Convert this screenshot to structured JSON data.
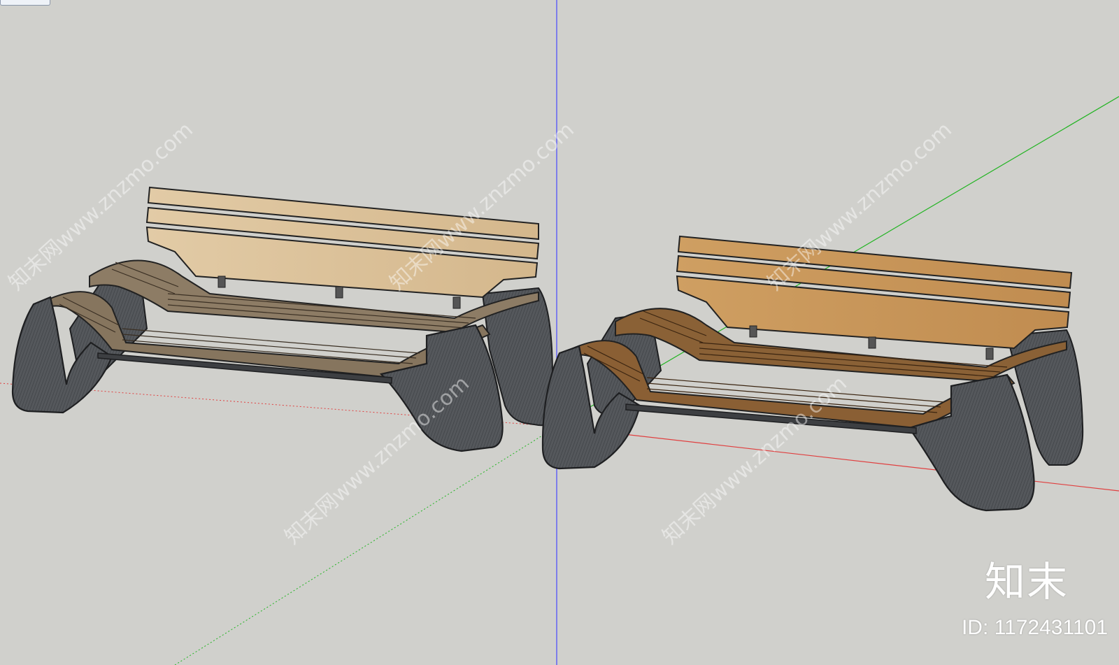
{
  "watermark": {
    "repeat_text": "知末网www.znzmo.com",
    "logo": "知末",
    "id_label": "ID: 1172431101"
  },
  "scene": {
    "colors": {
      "background": "#d0d0cc",
      "frame_metal": "#4a4c4f",
      "seat_wood_left": "#8b7a63",
      "back_wood_left": "#dcc29a",
      "seat_wood_right": "#8a6136",
      "back_wood_right": "#c9995e",
      "axis_blue": "#3a3aff",
      "axis_green": "#20c020",
      "axis_red": "#e04040"
    },
    "objects": [
      {
        "name": "bench-left",
        "style": "light wood"
      },
      {
        "name": "bench-right",
        "style": "warm wood"
      }
    ]
  }
}
